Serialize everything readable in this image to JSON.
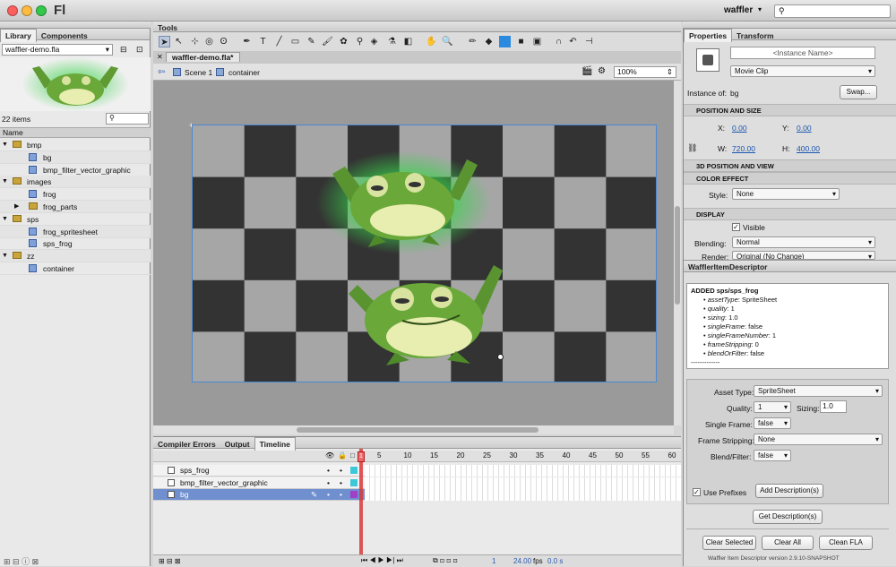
{
  "app": {
    "name": "Fl",
    "workspace": "waffler",
    "search_placeholder": ""
  },
  "library": {
    "tabs": [
      "Library",
      "Components"
    ],
    "file": "waffler-demo.fla",
    "count": "22 items",
    "column": "Name",
    "items": [
      {
        "label": "bmp",
        "type": "folder"
      },
      {
        "label": "bg",
        "type": "symbol"
      },
      {
        "label": "bmp_filter_vector_graphic",
        "type": "symbol"
      },
      {
        "label": "images",
        "type": "folder"
      },
      {
        "label": "frog",
        "type": "symbol"
      },
      {
        "label": "frog_parts",
        "type": "folder"
      },
      {
        "label": "sps",
        "type": "folder"
      },
      {
        "label": "frog_spritesheet",
        "type": "symbol"
      },
      {
        "label": "sps_frog",
        "type": "symbol"
      },
      {
        "label": "zz",
        "type": "folder"
      },
      {
        "label": "container",
        "type": "symbol"
      }
    ]
  },
  "tools": {
    "title": "Tools"
  },
  "document": {
    "tab": "waffler-demo.fla*",
    "scene": "Scene 1",
    "symbol": "container",
    "zoom": "100%"
  },
  "timeline": {
    "tabs": [
      "Compiler Errors",
      "Output",
      "Timeline"
    ],
    "layers": [
      "sps_frog",
      "bmp_filter_vector_graphic",
      "bg"
    ],
    "frame_labels": [
      "1",
      "5",
      "10",
      "15",
      "20",
      "25",
      "30",
      "35",
      "40",
      "45",
      "50",
      "55",
      "60"
    ],
    "current_frame": "1",
    "fps": "24.00",
    "fps_unit": "fps",
    "time": "0.0 s"
  },
  "properties": {
    "tabs": [
      "Properties",
      "Transform"
    ],
    "instance_name_placeholder": "<Instance Name>",
    "symbol_type": "Movie Clip",
    "instance_of_label": "Instance of:",
    "instance_of": "bg",
    "swap": "Swap...",
    "position_section": "POSITION AND SIZE",
    "x_label": "X:",
    "x": "0.00",
    "y_label": "Y:",
    "y": "0.00",
    "w_label": "W:",
    "w": "720.00",
    "h_label": "H:",
    "h": "400.00",
    "section_3d": "3D POSITION AND VIEW",
    "color_section": "COLOR EFFECT",
    "style_label": "Style:",
    "style": "None",
    "display_section": "DISPLAY",
    "visible": "Visible",
    "blending_label": "Blending:",
    "blending": "Normal",
    "render_label": "Render:",
    "render": "Original (No Change)"
  },
  "waffler": {
    "title": "WafflerItemDescriptor",
    "log_title": "ADDED sps/sps_frog",
    "log_lines": [
      {
        "key": "assetType",
        "value": "SpriteSheet"
      },
      {
        "key": "quality",
        "value": "1"
      },
      {
        "key": "sizing",
        "value": "1.0"
      },
      {
        "key": "singleFrame",
        "value": "false"
      },
      {
        "key": "singleFrameNumber",
        "value": "1"
      },
      {
        "key": "frameStripping",
        "value": "0"
      },
      {
        "key": "blendOrFilter",
        "value": "false"
      }
    ],
    "log_end": "-------------",
    "asset_type_label": "Asset Type:",
    "asset_type": "SpriteSheet",
    "quality_label": "Quality:",
    "quality": "1",
    "sizing_label": "Sizing:",
    "sizing": "1.0",
    "single_frame_label": "Single Frame:",
    "single_frame": "false",
    "frame_stripping_label": "Frame Stripping:",
    "frame_stripping": "None",
    "blend_label": "Blend/Filter:",
    "blend": "false",
    "use_prefixes": "Use Prefixes",
    "add_desc": "Add Description(s)",
    "get_desc": "Get Description(s)",
    "clear_selected": "Clear Selected",
    "clear_all": "Clear All",
    "clean_fla": "Clean FLA",
    "version": "Waffler Item Descriptor version 2.9.10-SNAPSHOT"
  },
  "colors": {
    "accent": "#4a88d4",
    "selection": "#6f8fcf",
    "playhead": "#d93a3a",
    "frog": "#6aa83a",
    "glow": "#39d34a"
  }
}
